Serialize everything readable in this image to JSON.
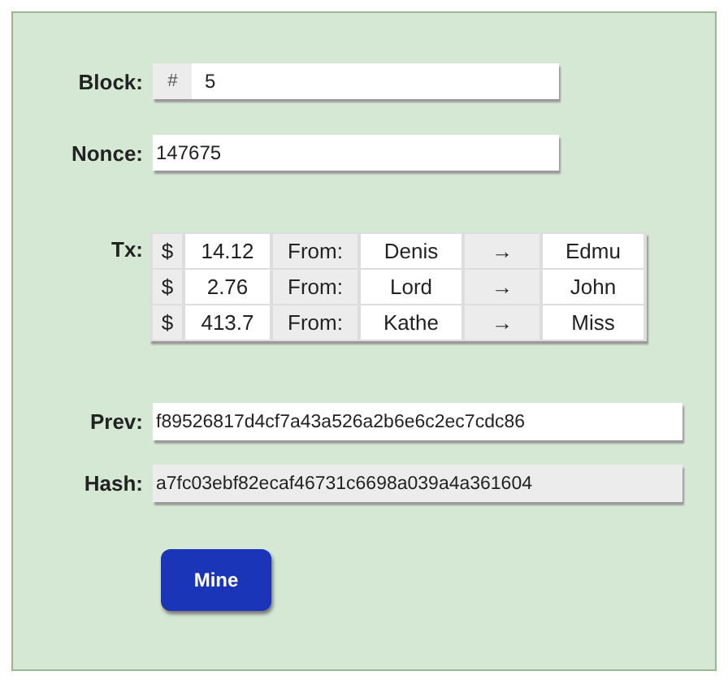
{
  "block": {
    "label": "Block:",
    "prefix": "#",
    "value": "5"
  },
  "nonce": {
    "label": "Nonce:",
    "value": "147675"
  },
  "tx": {
    "label": "Tx:",
    "rows": [
      {
        "currency": "$",
        "amount": "14.12",
        "from_label": "From:",
        "from": "Denis",
        "arrow": "→",
        "to": "Edmu"
      },
      {
        "currency": "$",
        "amount": "2.76",
        "from_label": "From:",
        "from": "Lord",
        "arrow": "→",
        "to": "John"
      },
      {
        "currency": "$",
        "amount": "413.7",
        "from_label": "From:",
        "from": "Kathe",
        "arrow": "→",
        "to": "Miss"
      }
    ]
  },
  "hashes": [
    {
      "label": "Prev:",
      "value": "f89526817d4cf7a43a526a2b6e6c2ec7cdc86",
      "readonly": false
    },
    {
      "label": "Hash:",
      "value": "a7fc03ebf82ecaf46731c6698a039a4a361604",
      "readonly": true
    }
  ],
  "button": "Mine"
}
